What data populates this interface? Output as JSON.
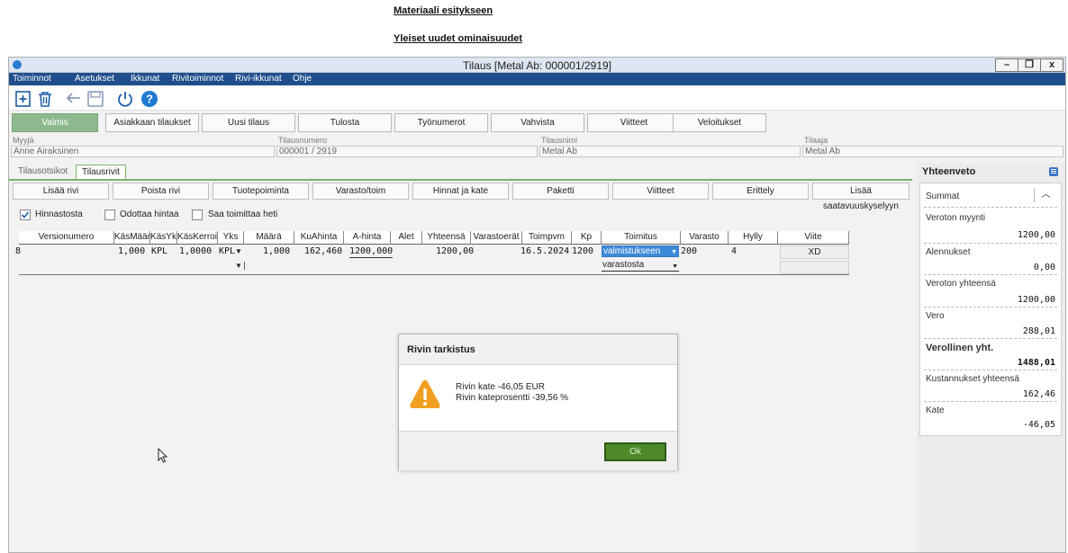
{
  "doc": {
    "heading1": "Materiaali esitykseen",
    "heading2": "Yleiset uudet ominaisuudet"
  },
  "window": {
    "title": "Tilaus [Metal Ab: 000001/2919]",
    "controls": {
      "minimize": "–",
      "restore": "❐",
      "close": "x"
    }
  },
  "menu": {
    "items": [
      "Toiminnot",
      "Asetukset",
      "Ikkunat",
      "Rivitoiminnot",
      "Rivi-ikkunat",
      "Ohje"
    ]
  },
  "actions": {
    "buttons": [
      "Valmis",
      "Asiakkaan tilaukset",
      "Uusi tilaus",
      "Tulosta",
      "Työnumerot",
      "Vahvista",
      "Viitteet",
      "Veloitukset"
    ]
  },
  "header_fields": {
    "myyja_label": "Myyjä",
    "myyja_value": "Anne Airaksinen",
    "tilausnumero_label": "Tilausnumero",
    "tilausnumero_value": "000001 / 2919",
    "tilausnimi_label": "Tilausnimi",
    "tilausnimi_value": "Metal Ab",
    "tilaaja_label": "Tilaaja",
    "tilaaja_value": "Metal Ab"
  },
  "tabs": [
    "Tilausotsikot",
    "Tilausrivit"
  ],
  "row_buttons": [
    "Lisää rivi",
    "Poista rivi",
    "Tuotepoiminta",
    "Varasto/toim",
    "Hinnat ja kate",
    "Paketti",
    "Viitteet",
    "Erittely",
    "Lisää saatavuuskyselyyn"
  ],
  "checkboxes": [
    {
      "label": "Hinnastosta",
      "checked": true
    },
    {
      "label": "Odottaa hintaa",
      "checked": false
    },
    {
      "label": "Saa toimittaa heti",
      "checked": false
    }
  ],
  "grid": {
    "headers": [
      "Versionumero",
      "KäsMäärä",
      "KäsYk",
      "KäsKerroi",
      "Yks",
      "Määrä",
      "KuAhinta",
      "A-hinta",
      "Alet",
      "Yhteensä",
      "Varastoerät",
      "Toimpvm",
      "Kp",
      "Toimitus",
      "Varasto",
      "Hylly",
      "Viite"
    ],
    "row": {
      "versionumero": "8",
      "kasmaara": "1,000",
      "kasyk": "KPL",
      "kaskerroin": "1,0000",
      "yks": "KPL",
      "maara": "1,000",
      "kuahinta": "162,460",
      "ahinta": "1200,000",
      "yhteensa": "1200,00",
      "toimpvm": "16.5.2024",
      "kp": "1200",
      "toimitus": "valmistukseen",
      "toimitus2": "varastosta",
      "varasto": "200",
      "hylly": "4",
      "viite": "XD"
    }
  },
  "summary": {
    "header": "Yhteenveto",
    "section": "Summat",
    "items": [
      {
        "label": "Veroton myynti",
        "value": "1200,00"
      },
      {
        "label": "Alennukset",
        "value": "0,00"
      },
      {
        "label": "Veroton yhteensä",
        "value": "1200,00"
      },
      {
        "label": "Vero",
        "value": "288,01"
      },
      {
        "label": "Verollinen yht.",
        "value": "1488,01"
      },
      {
        "label": "Kustannukset yhteensä",
        "value": "162,46"
      },
      {
        "label": "Kate",
        "value": "-46,05"
      }
    ]
  },
  "dialog": {
    "title": "Rivin tarkistus",
    "line1": "Rivin kate -46,05 EUR",
    "line2": "Rivin kateprosentti -39,56 %",
    "ok": "Ok"
  },
  "colors": {
    "menubar": "#1f4e8c",
    "accent_green": "#7bb36b",
    "ok_button": "#4d8a2a",
    "warning": "#f0a020"
  }
}
